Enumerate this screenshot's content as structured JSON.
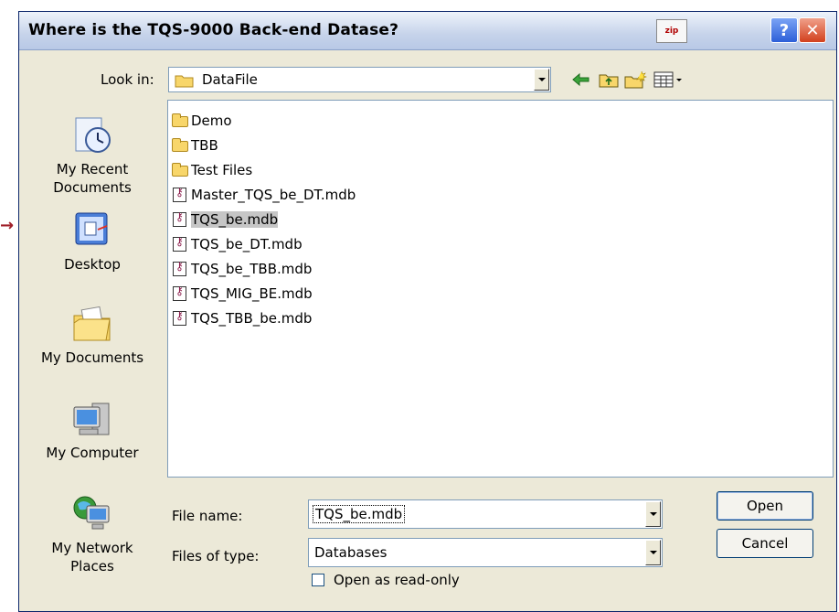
{
  "window": {
    "title": "Where is the TQS-9000 Back-end Datase?",
    "zip_label": "zip",
    "help_symbol": "?",
    "close_symbol": "✕"
  },
  "lookin": {
    "label": "Look in:",
    "value": "DataFile"
  },
  "toolbar": {
    "back_icon": "back-arrow-icon",
    "up_icon": "up-one-level-icon",
    "new_folder_icon": "new-folder-icon",
    "view_icon": "view-menu-icon"
  },
  "places": [
    {
      "label": "My Recent\nDocuments",
      "icon": "recent-documents-icon"
    },
    {
      "label": "Desktop",
      "icon": "desktop-icon"
    },
    {
      "label": "My Documents",
      "icon": "my-documents-icon"
    },
    {
      "label": "My Computer",
      "icon": "my-computer-icon"
    },
    {
      "label": "My Network\nPlaces",
      "icon": "network-places-icon"
    }
  ],
  "files": [
    {
      "name": "Demo",
      "type": "folder"
    },
    {
      "name": "TBB",
      "type": "folder"
    },
    {
      "name": "Test Files",
      "type": "folder"
    },
    {
      "name": "Master_TQS_be_DT.mdb",
      "type": "mdb"
    },
    {
      "name": "TQS_be.mdb",
      "type": "mdb",
      "selected": true
    },
    {
      "name": "TQS_be_DT.mdb",
      "type": "mdb"
    },
    {
      "name": "TQS_be_TBB.mdb",
      "type": "mdb"
    },
    {
      "name": "TQS_MIG_BE.mdb",
      "type": "mdb"
    },
    {
      "name": "TQS_TBB_be.mdb",
      "type": "mdb"
    }
  ],
  "filename": {
    "label": "File name:",
    "value": "TQS_be.mdb"
  },
  "filetype": {
    "label": "Files of type:",
    "value": "Databases"
  },
  "buttons": {
    "open": "Open",
    "cancel": "Cancel"
  },
  "readonly": {
    "label": "Open as read-only",
    "checked": false
  },
  "annotation": {
    "arrow": "→"
  }
}
